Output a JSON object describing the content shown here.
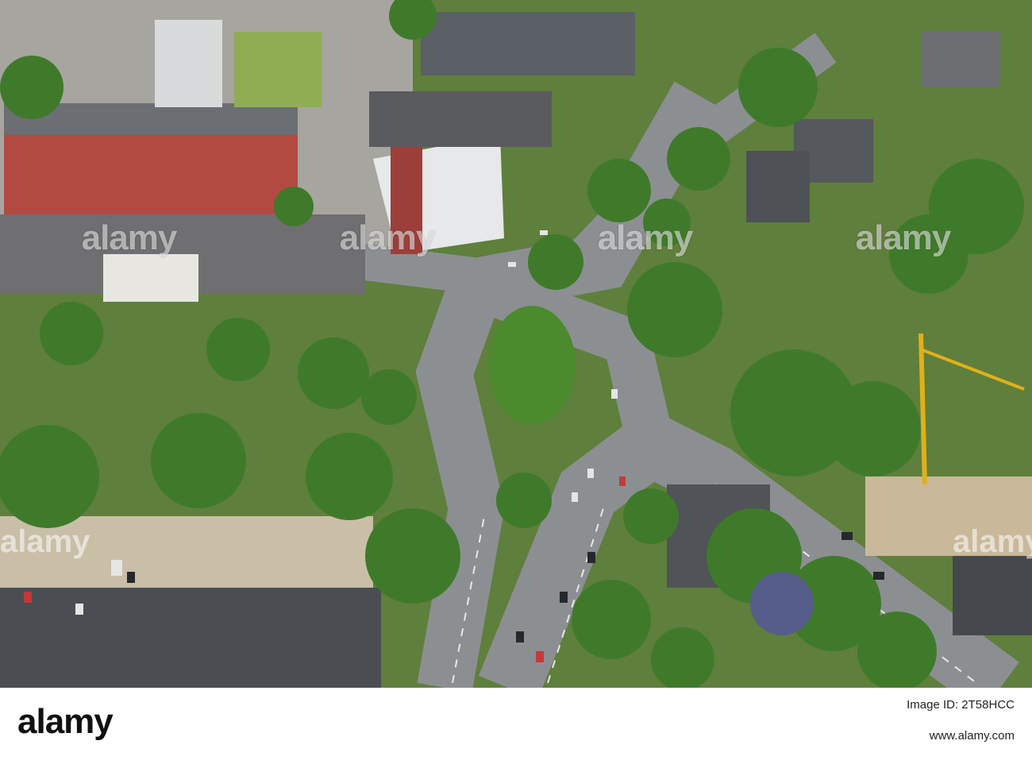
{
  "watermark": {
    "brand": "alamy",
    "repeat": [
      "alamy",
      "alamy",
      "alamy",
      "alamy",
      "alamy",
      "alamy"
    ]
  },
  "footer": {
    "logo": "alamy",
    "image_id_label": "Image ID: 2T58HCC",
    "url": "www.alamy.com"
  },
  "colors": {
    "road": "#8c8f92",
    "foliage": "#3f7a2a",
    "roof_dark": "#4a4d52",
    "roof_red": "#b24a42"
  }
}
